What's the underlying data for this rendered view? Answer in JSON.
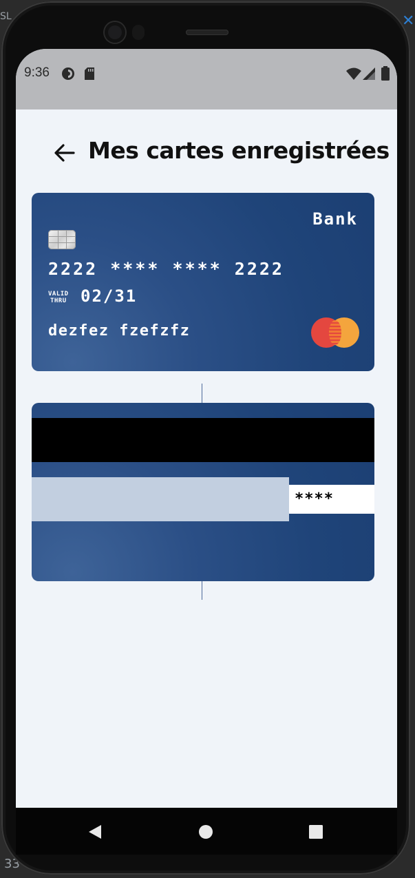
{
  "status": {
    "time": "9:36"
  },
  "header": {
    "title": "Mes cartes enregistrées"
  },
  "card_front": {
    "bank_name": "Bank",
    "number": "2222 **** **** 2222",
    "valid_line1": "VALID",
    "valid_line2": "THRU",
    "expiry": "02/31",
    "holder": "dezfez fzefzfz",
    "network_icon": "mastercard-icon"
  },
  "card_back": {
    "cvv": "****"
  },
  "desktop_fragments": {
    "top_left": "SL",
    "bottom_left": "33"
  },
  "colors": {
    "card_blue": "#1f4479",
    "screen_bg": "#f0f4f9",
    "statusbar": "#b7b8bb",
    "mc_red": "#e4473f",
    "mc_yellow": "#f4a53d"
  }
}
